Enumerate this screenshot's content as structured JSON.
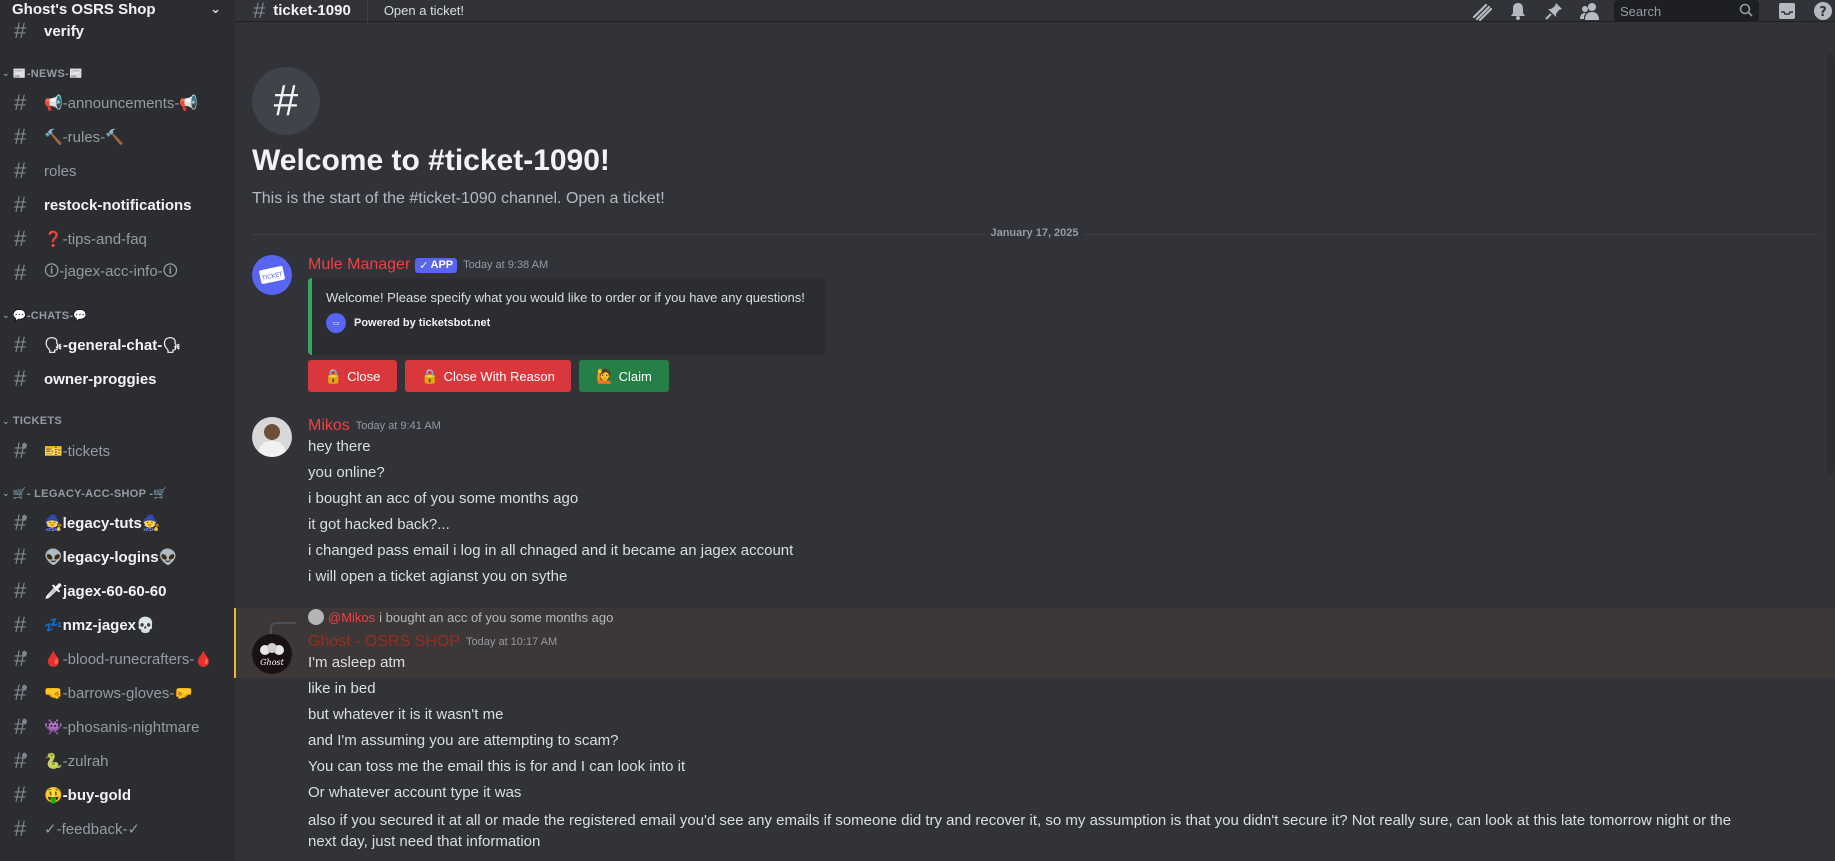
{
  "server": {
    "name": "Ghost's OSRS Shop"
  },
  "sidebar": {
    "top_channel": "verify",
    "news_category": "📰-NEWS-📰",
    "news_channels": [
      "📢-announcements-📢",
      "🔨-rules-🔨",
      "roles",
      "restock-notifications",
      "❓-tips-and-faq",
      "🛈-jagex-acc-info-🛈"
    ],
    "chats_category": "💬-CHATS-💬",
    "chat_channels": [
      "🗣-general-chat-🗣",
      "owner-proggies"
    ],
    "tickets_category": "TICKETS",
    "ticket_channels": [
      "🎫-tickets"
    ],
    "legacy_category": "🛒- LEGACY-ACC-SHOP -🛒",
    "legacy_channels": [
      "🧙legacy-tuts🧙",
      "👽legacy-logins👽",
      "🗡jagex-60-60-60",
      "💤nmz-jagex💀",
      "🩸-blood-runecrafters-🩸",
      "🤜-barrows-gloves-🤛",
      "👾-phosanis-nightmare",
      "🐍-zulrah",
      "🤑-buy-gold",
      "✓-feedback-✓"
    ]
  },
  "topbar": {
    "channel": "ticket-1090",
    "topic": "Open a ticket!",
    "search_placeholder": "Search"
  },
  "welcome": {
    "title": "Welcome to #ticket-1090!",
    "subtitle": "This is the start of the #ticket-1090 channel. Open a ticket!"
  },
  "date_divider": "January 17, 2025",
  "messages": {
    "bot": {
      "author": "Mule Manager",
      "tag": "APP",
      "timestamp": "Today at 9:38 AM",
      "embed_text": "Welcome! Please specify what you would like to order or if you have any questions!",
      "embed_footer": "Powered by ticketsbot.net",
      "buttons": {
        "close": "Close",
        "close_reason": "Close With Reason",
        "claim": "Claim"
      },
      "color": "#f23f42"
    },
    "mikos": {
      "author": "Mikos",
      "timestamp": "Today at 9:41 AM",
      "lines": [
        "hey there",
        "you online?",
        "i bought an acc of you some months ago",
        "it got hacked back?...",
        "i changed pass email i log in all chnaged and it became an jagex account",
        "i will open a ticket agianst you on sythe"
      ],
      "color": "#f23f42"
    },
    "ghost": {
      "reply_mention": "@Mikos",
      "reply_text": "i bought an acc of you some months ago",
      "author": "Ghost - OSRS SHOP",
      "timestamp": "Today at 10:17 AM",
      "lines": [
        "I'm asleep atm",
        "like in bed",
        "but whatever it is it wasn't me",
        "and I'm assuming you are attempting to scam?",
        "You can toss me the email this is for and I can look into it",
        "Or whatever account type it was",
        "also if you secured it at all or made the registered email you'd see any emails if someone did try and recover it, so my assumption is that you didn't secure it? Not really sure, can look at this late tomorrow night or the",
        "next day, just need that information"
      ],
      "color": "#992d22"
    }
  }
}
